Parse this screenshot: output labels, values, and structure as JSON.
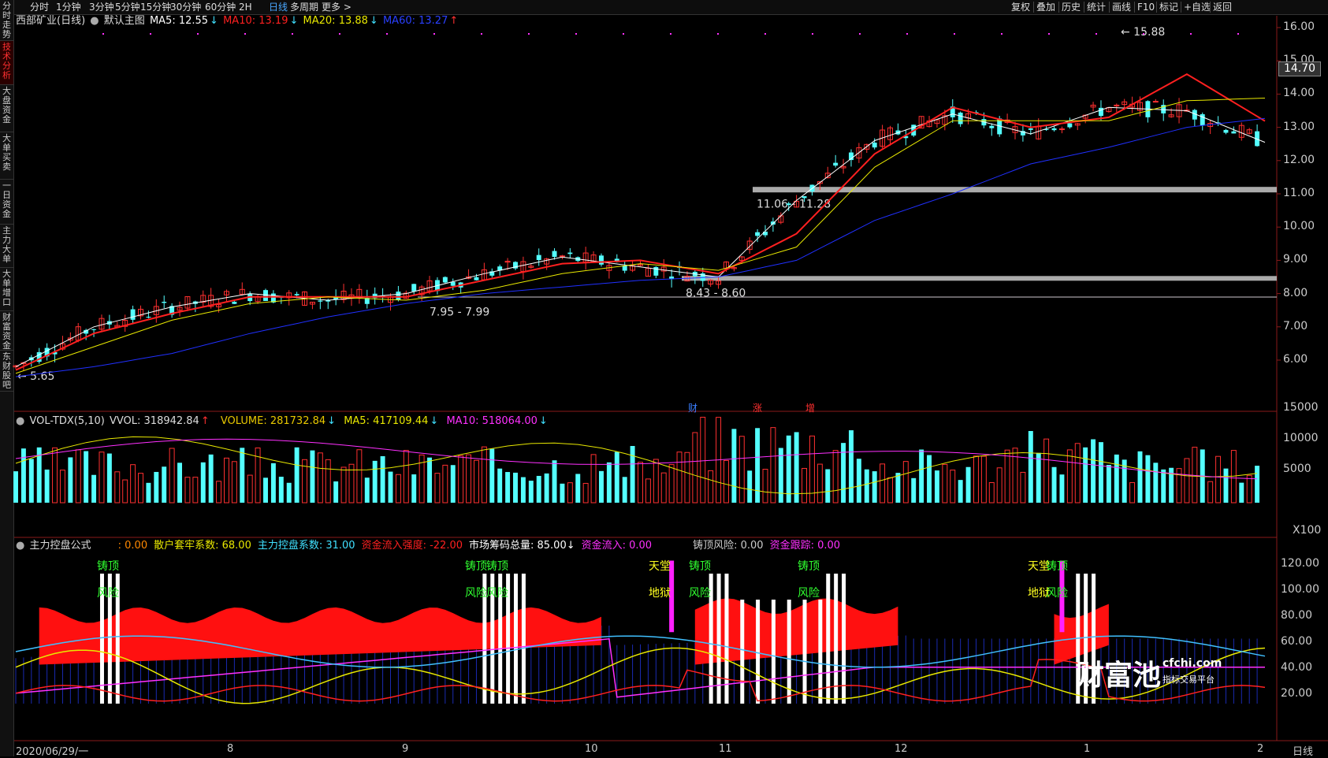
{
  "left_tabs": [
    {
      "label": "分时走势",
      "active": false
    },
    {
      "label": "技术分析",
      "active": true
    },
    {
      "label": "大盘资金",
      "active": false
    },
    {
      "label": "大单买卖",
      "active": false
    },
    {
      "label": "一日资金",
      "active": false
    },
    {
      "label": "主力大单",
      "active": false
    },
    {
      "label": "大单增口",
      "active": false
    },
    {
      "label": "财富资金",
      "active": false
    },
    {
      "label": "东财股吧",
      "active": false
    }
  ],
  "toolbar": {
    "periods": [
      "分时",
      "1分钟",
      "3分钟",
      "5分钟",
      "15分钟",
      "30分钟",
      "60分钟",
      "2H",
      "日线",
      "多周期",
      "更多 >"
    ],
    "active_period": "日线",
    "right_buttons": [
      "复权",
      "叠加",
      "历史",
      "统计",
      "画线",
      "F10",
      "标记",
      "+自选",
      "返回"
    ]
  },
  "main_chart": {
    "stock": "西部矿业(日线)",
    "template": "默认主图",
    "ma5": {
      "label": "MA5: 12.55",
      "arrow": "↓",
      "color": "#ffffff"
    },
    "ma10": {
      "label": "MA10: 13.19",
      "arrow": "↓",
      "color": "#ff2020"
    },
    "ma20": {
      "label": "MA20: 13.88",
      "arrow": "↓",
      "color": "#e8e800"
    },
    "ma60": {
      "label": "MA60: 13.27",
      "arrow": "↑",
      "color": "#2030ff"
    },
    "y_axis": [
      "16.00",
      "15.00",
      "14.00",
      "13.00",
      "12.00",
      "11.00",
      "10.00",
      "9.00",
      "8.00",
      "7.00",
      "6.00"
    ],
    "current_price": "14.70",
    "high_label": "15.88",
    "low_label": "5.65",
    "zones": [
      "11.06 - 11.28",
      "8.43 - 8.60",
      "7.95 - 7.99"
    ],
    "markers": [
      "财",
      "涨",
      "增"
    ]
  },
  "volume_chart": {
    "title": "VOL-TDX(5,10)",
    "vvol": "VVOL: 318942.84",
    "vvol_arrow": "↑",
    "volume": "VOLUME: 281732.84",
    "volume_arrow": "↓",
    "ma5": "MA5: 417109.44",
    "ma5_arrow": "↓",
    "ma10": "MA10: 518064.00",
    "ma10_arrow": "↓",
    "y_axis": [
      "15000",
      "10000",
      "5000"
    ],
    "unit": "X100"
  },
  "indicator_chart": {
    "title": "主力控盘公式",
    "fields": [
      {
        "label": ": 0.00",
        "color": "#ff8800"
      },
      {
        "label": "散户套牢系数: 68.00",
        "color": "#e8e800"
      },
      {
        "label": "主力控盘系数: 31.00",
        "color": "#40e0ff"
      },
      {
        "label": "资金流入强度: -22.00",
        "color": "#ff2020"
      },
      {
        "label": "市场筹码总量: 85.00↓",
        "color": "#ffffff"
      },
      {
        "label": "资金流入: 0.00",
        "color": "#ff30ff"
      },
      {
        "label": "铸顶风险: 0.00",
        "color": "#cccccc"
      },
      {
        "label": "资金跟踪: 0.00",
        "color": "#ff30ff"
      }
    ],
    "y_axis": [
      "120.00",
      "100.00",
      "80.00",
      "60.00",
      "40.00",
      "20.00"
    ],
    "signals": [
      "铸顶",
      "风险",
      "天堂",
      "地狱"
    ]
  },
  "x_axis": [
    "2020/06/29/一",
    "8",
    "9",
    "10",
    "11",
    "12",
    "1",
    "2"
  ],
  "period_label": "日线",
  "watermark": {
    "brand": "财富池",
    "site": "cfchi.com",
    "slogan": "指标交易平台"
  },
  "colors": {
    "up": "#ff3030",
    "down": "#54ffff",
    "ma5": "#ffffff",
    "ma10": "#ff2020",
    "ma20": "#e8e800",
    "ma60": "#2030ff"
  },
  "chart_data": {
    "type": "line",
    "x": [
      0,
      10,
      20,
      30,
      40,
      50,
      60,
      70,
      80,
      90,
      100,
      110,
      120,
      130,
      140,
      150,
      160
    ],
    "series": [
      {
        "name": "MA5",
        "values": [
          5.8,
          7.0,
          7.6,
          8.0,
          7.8,
          8.0,
          8.6,
          9.1,
          8.8,
          8.5,
          10.8,
          12.6,
          13.4,
          12.8,
          13.6,
          13.5,
          12.55
        ]
      },
      {
        "name": "MA10",
        "values": [
          5.7,
          6.8,
          7.4,
          7.9,
          7.9,
          7.9,
          8.4,
          8.9,
          9.0,
          8.6,
          9.8,
          12.2,
          13.6,
          13.0,
          13.3,
          14.6,
          13.19
        ]
      },
      {
        "name": "MA20",
        "values": [
          5.6,
          6.4,
          7.2,
          7.7,
          7.9,
          7.8,
          8.1,
          8.6,
          8.9,
          8.7,
          9.4,
          11.8,
          13.2,
          13.2,
          13.2,
          13.8,
          13.88
        ]
      },
      {
        "name": "MA60",
        "values": [
          5.5,
          5.8,
          6.2,
          6.8,
          7.3,
          7.7,
          8.0,
          8.2,
          8.4,
          8.5,
          9.0,
          10.2,
          11.0,
          11.9,
          12.4,
          13.0,
          13.27
        ]
      }
    ],
    "ylim": [
      5.5,
      16.2
    ]
  }
}
